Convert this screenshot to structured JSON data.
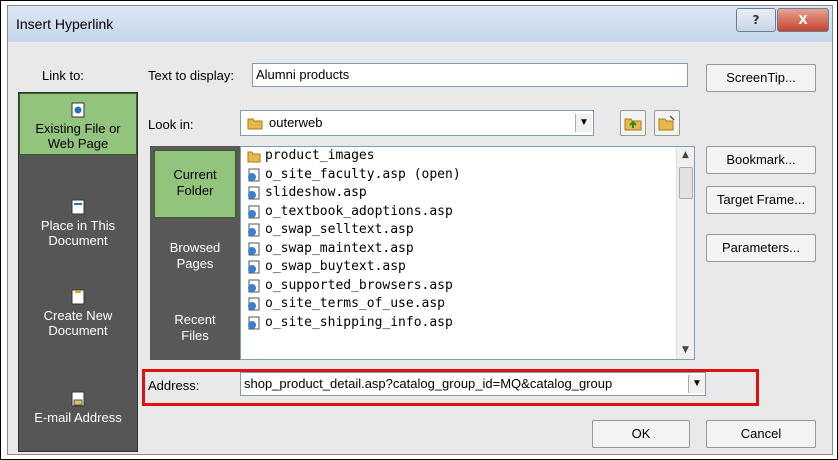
{
  "window": {
    "title": "Insert Hyperlink",
    "help_glyph": "?",
    "close_glyph": "X"
  },
  "labels": {
    "link_to": "Link to:",
    "text_to_display": "Text to display:",
    "look_in": "Look in:",
    "address": "Address:"
  },
  "fields": {
    "text_to_display_value": "Alumni products",
    "look_in_value": "outerweb",
    "address_value": "shop_product_detail.asp?catalog_group_id=MQ&catalog_group"
  },
  "link_to_items": [
    {
      "line1": "Existing File or",
      "line2": "Web Page",
      "selected": true
    },
    {
      "line1": "Place in This",
      "line2": "Document",
      "selected": false
    },
    {
      "line1": "Create New",
      "line2": "Document",
      "selected": false
    },
    {
      "line1": "E-mail Address",
      "line2": "",
      "selected": false
    }
  ],
  "folder_items": [
    {
      "line1": "Current",
      "line2": "Folder",
      "selected": true
    },
    {
      "line1": "Browsed",
      "line2": "Pages",
      "selected": false
    },
    {
      "line1": "Recent",
      "line2": "Files",
      "selected": false
    }
  ],
  "files": [
    {
      "name": "product_images",
      "type": "folder"
    },
    {
      "name": "o_site_faculty.asp (open)",
      "type": "asp"
    },
    {
      "name": "slideshow.asp",
      "type": "asp"
    },
    {
      "name": "o_textbook_adoptions.asp",
      "type": "asp"
    },
    {
      "name": "o_swap_selltext.asp",
      "type": "asp"
    },
    {
      "name": "o_swap_maintext.asp",
      "type": "asp"
    },
    {
      "name": "o_swap_buytext.asp",
      "type": "asp"
    },
    {
      "name": "o_supported_browsers.asp",
      "type": "asp"
    },
    {
      "name": "o_site_terms_of_use.asp",
      "type": "asp"
    },
    {
      "name": "o_site_shipping_info.asp",
      "type": "asp"
    }
  ],
  "buttons": {
    "screentip": "ScreenTip...",
    "bookmark": "Bookmark...",
    "target_frame": "Target Frame...",
    "parameters": "Parameters...",
    "ok": "OK",
    "cancel": "Cancel"
  },
  "colors": {
    "highlight_border": "#e01010",
    "selected_green": "#93c47d",
    "sidebar_gray": "#565656"
  }
}
